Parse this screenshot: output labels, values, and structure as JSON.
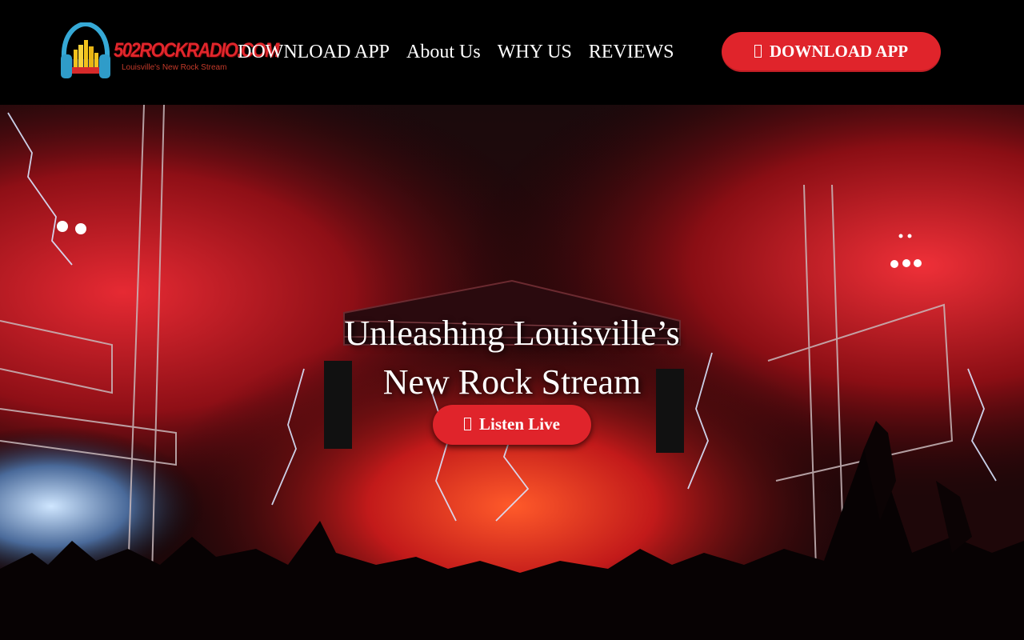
{
  "header": {
    "logo_title": "502ROCKRADIO.COM",
    "logo_tagline": "Louisville's New Rock Stream",
    "nav": [
      {
        "label": "DOWNLOAD APP"
      },
      {
        "label": "About Us"
      },
      {
        "label": "WHY US"
      },
      {
        "label": "REVIEWS"
      }
    ],
    "cta_label": "DOWNLOAD APP",
    "cta_icon": "mobile-icon"
  },
  "hero": {
    "title_line1": "Unleashing Louisville’s",
    "title_line2": "New Rock Stream",
    "listen_label": "Listen Live",
    "listen_icon": "play-icon",
    "background": "concert-stage-photo"
  },
  "colors": {
    "accent": "#e0242b",
    "header_bg": "#000000",
    "text": "#ffffff"
  }
}
